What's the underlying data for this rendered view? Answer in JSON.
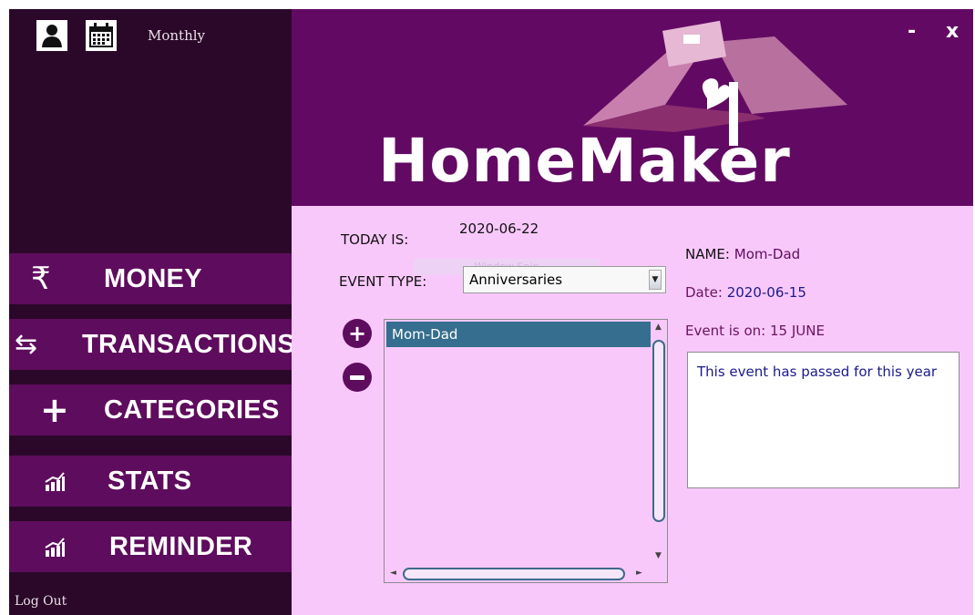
{
  "topbar": {
    "view_label": "Monthly"
  },
  "window_controls": {
    "minimize": "-",
    "close": "x"
  },
  "header": {
    "brand": "HomeMaker"
  },
  "sidebar": {
    "items": [
      {
        "label": "MONEY",
        "icon": "rupee-icon"
      },
      {
        "label": "TRANSACTIONS",
        "icon": "transfer-arrows-icon"
      },
      {
        "label": "CATEGORIES",
        "icon": "plus-icon"
      },
      {
        "label": "STATS",
        "icon": "bar-chart-icon"
      },
      {
        "label": "REMINDER",
        "icon": "bar-chart-icon"
      }
    ],
    "logout": "Log Out"
  },
  "main": {
    "today_label": "TODAY IS:",
    "today_value": "2020-06-22",
    "event_type_label": "EVENT TYPE:",
    "event_type_value": "Anniversaries",
    "events": [
      "Mom-Dad"
    ],
    "ghost_text": "Window Snip",
    "name_label": "NAME:",
    "name_value": "Mom-Dad",
    "date_label": "Date:",
    "date_value": "2020-06-15",
    "event_on_label": "Event is on:",
    "event_on_value": "15 JUNE",
    "message": "This event has passed for this year"
  },
  "colors": {
    "sidebar_bg": "#2b0829",
    "nav_bg": "#5e0c5d",
    "header_bg": "#620a63",
    "content_bg": "#f9c8fb",
    "selection": "#356e8e"
  }
}
